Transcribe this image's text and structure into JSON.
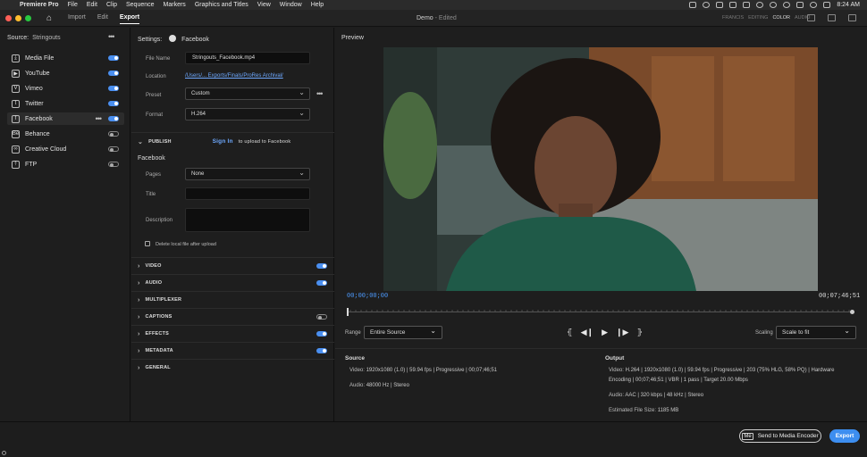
{
  "mac_menu": {
    "items": [
      "Premiere Pro",
      "File",
      "Edit",
      "Clip",
      "Sequence",
      "Markers",
      "Graphics and Titles",
      "View",
      "Window",
      "Help"
    ],
    "clock": "8:24 AM"
  },
  "app_header": {
    "tabs": [
      "Import",
      "Edit",
      "Export"
    ],
    "active_tab": "Export",
    "doc_title": "Demo",
    "doc_status": "- Edited",
    "workspace_labels": [
      "FRANCIS",
      "EDITING",
      "COLOR",
      "AUDIO"
    ]
  },
  "source_panel": {
    "label": "Source:",
    "value": "Stringouts",
    "destinations": [
      {
        "label": "Media File",
        "icon": "download-icon",
        "on": true
      },
      {
        "label": "YouTube",
        "icon": "youtube-icon",
        "on": true
      },
      {
        "label": "Vimeo",
        "icon": "vimeo-icon",
        "on": true
      },
      {
        "label": "Twitter",
        "icon": "twitter-icon",
        "on": true
      },
      {
        "label": "Facebook",
        "icon": "facebook-icon",
        "on": true,
        "selected": true
      },
      {
        "label": "Behance",
        "icon": "behance-icon",
        "on": false
      },
      {
        "label": "Creative Cloud",
        "icon": "creative-cloud-icon",
        "on": false
      },
      {
        "label": "FTP",
        "icon": "upload-icon",
        "on": false
      }
    ]
  },
  "settings": {
    "label": "Settings:",
    "destination": "Facebook",
    "file_name_label": "File Name",
    "file_name": "Stringouts_Facebook.mp4",
    "location_label": "Location",
    "location": "/Users/... Exports/Finals/ProRes Archival/",
    "preset_label": "Preset",
    "preset": "Custom",
    "format_label": "Format",
    "format": "H.264",
    "publish_label": "PUBLISH",
    "sign_in": "Sign In",
    "sign_in_suffix": "to upload to Facebook",
    "facebook_heading": "Facebook",
    "pages_label": "Pages",
    "pages_value": "None",
    "title_label": "Title",
    "title_value": "",
    "description_label": "Description",
    "description_value": "",
    "delete_local_label": "Delete local file after upload",
    "sections": [
      {
        "label": "VIDEO",
        "toggle": "on"
      },
      {
        "label": "AUDIO",
        "toggle": "on"
      },
      {
        "label": "MULTIPLEXER",
        "toggle": "none"
      },
      {
        "label": "CAPTIONS",
        "toggle": "off"
      },
      {
        "label": "EFFECTS",
        "toggle": "on"
      },
      {
        "label": "METADATA",
        "toggle": "on"
      },
      {
        "label": "GENERAL",
        "toggle": "none"
      }
    ]
  },
  "preview": {
    "title": "Preview",
    "timecode_start": "00;00;00;00",
    "timecode_end": "00;07;46;51",
    "range_label": "Range",
    "range_value": "Entire Source",
    "scaling_label": "Scaling",
    "scaling_value": "Scale to fit",
    "playhead_fraction": 0.0
  },
  "source_info": {
    "heading": "Source",
    "video_label": "Video:",
    "video": "1920x1080 (1.0)  |  59.94 fps  |  Progressive  |  00;07;46;51",
    "audio_label": "Audio:",
    "audio": "48000 Hz  |  Stereo"
  },
  "output_info": {
    "heading": "Output",
    "video_label": "Video:",
    "video_line1": "H.264  |  1920x1080 (1.0)  |  59.94 fps  |  Progressive  |  203 (75% HLG, 58% PQ)  |  Hardware",
    "video_line2": "Encoding  |  00;07;46;51  |  VBR  |  1 pass  |  Target 20.00 Mbps",
    "audio_label": "Audio:",
    "audio": "AAC  |  320 kbps  |  48 kHz  |  Stereo",
    "size_label": "Estimated File Size:",
    "size": "1185 MB"
  },
  "buttons": {
    "send_to_encoder": "Send to Media Encoder",
    "export": "Export"
  },
  "colors": {
    "accent": "#3d8ef0",
    "timecode": "#4d9bff"
  }
}
